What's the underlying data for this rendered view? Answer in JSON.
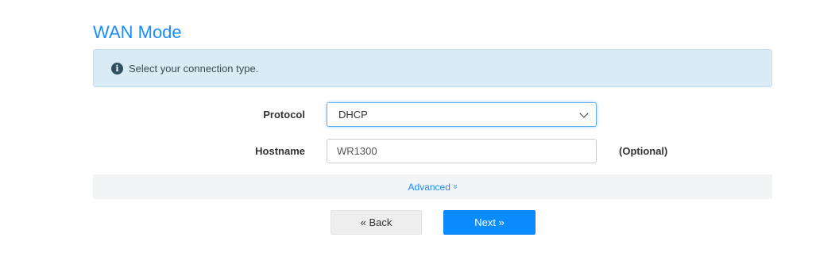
{
  "page": {
    "title": "WAN Mode"
  },
  "info": {
    "icon": "info-circle-icon",
    "text": "Select your connection type."
  },
  "form": {
    "protocol": {
      "label": "Protocol",
      "selected": "DHCP"
    },
    "hostname": {
      "label": "Hostname",
      "value": "WR1300",
      "hint": "(Optional)"
    }
  },
  "advanced": {
    "label": "Advanced",
    "icon_glyph": "≫"
  },
  "buttons": {
    "back": "« Back",
    "next": "Next »"
  },
  "colors": {
    "accent": "#1a8cff",
    "info_bg": "#d9ecf5",
    "primary_button": "#0a8cff",
    "secondary_button": "#eeeeee"
  }
}
